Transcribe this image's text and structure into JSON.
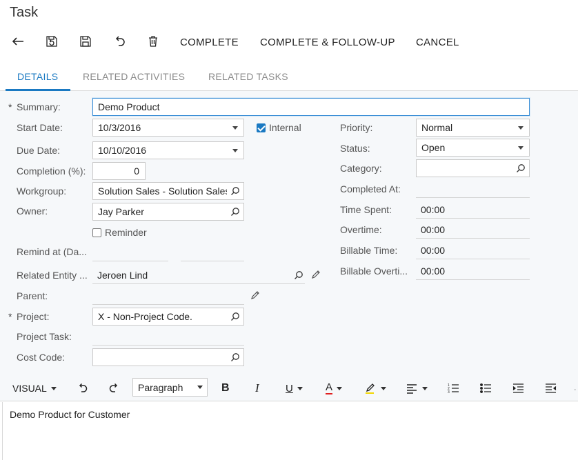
{
  "page": {
    "title": "Task"
  },
  "toolbar": {
    "back_icon": "arrow-left-icon",
    "revert_icon": "save-revert-icon",
    "save_icon": "save-icon",
    "undo_icon": "undo-icon",
    "delete_icon": "trash-icon",
    "complete_label": "COMPLETE",
    "complete_followup_label": "COMPLETE & FOLLOW-UP",
    "cancel_label": "CANCEL"
  },
  "tabs": [
    {
      "label": "DETAILS",
      "active": true
    },
    {
      "label": "RELATED ACTIVITIES",
      "active": false
    },
    {
      "label": "RELATED TASKS",
      "active": false
    }
  ],
  "form": {
    "summary": {
      "label": "Summary:",
      "value": "Demo Product",
      "required": "*"
    },
    "start_date": {
      "label": "Start Date:",
      "value": "10/3/2016"
    },
    "internal": {
      "label": "Internal",
      "checked": true
    },
    "due_date": {
      "label": "Due Date:",
      "value": "10/10/2016"
    },
    "completion": {
      "label": "Completion (%):",
      "value": "0"
    },
    "workgroup": {
      "label": "Workgroup:",
      "value": "Solution Sales - Solution Sales"
    },
    "owner": {
      "label": "Owner:",
      "value": "Jay Parker"
    },
    "reminder": {
      "label": "Reminder",
      "checked": false
    },
    "remind_at": {
      "label": "Remind at (Da..."
    },
    "related_entity": {
      "label": "Related Entity ...",
      "value": "Jeroen Lind"
    },
    "parent": {
      "label": "Parent:"
    },
    "project": {
      "label": "Project:",
      "value": "X - Non-Project Code.",
      "required": "*"
    },
    "project_task": {
      "label": "Project Task:"
    },
    "cost_code": {
      "label": "Cost Code:"
    },
    "priority": {
      "label": "Priority:",
      "value": "Normal"
    },
    "status": {
      "label": "Status:",
      "value": "Open"
    },
    "category": {
      "label": "Category:"
    },
    "completed_at": {
      "label": "Completed At:"
    },
    "time_spent": {
      "label": "Time Spent:",
      "value": "00:00"
    },
    "overtime": {
      "label": "Overtime:",
      "value": "00:00"
    },
    "billable_time": {
      "label": "Billable Time:",
      "value": "00:00"
    },
    "billable_overtime": {
      "label": "Billable Overti...",
      "value": "00:00"
    }
  },
  "editor": {
    "mode_label": "VISUAL",
    "paragraph_label": "Paragraph",
    "bold": "B",
    "italic": "I",
    "underline": "U",
    "font_color": "A",
    "font_color_hex": "#e02020",
    "highlight_hex": "#f2d600",
    "content": "Demo Product for Customer"
  }
}
